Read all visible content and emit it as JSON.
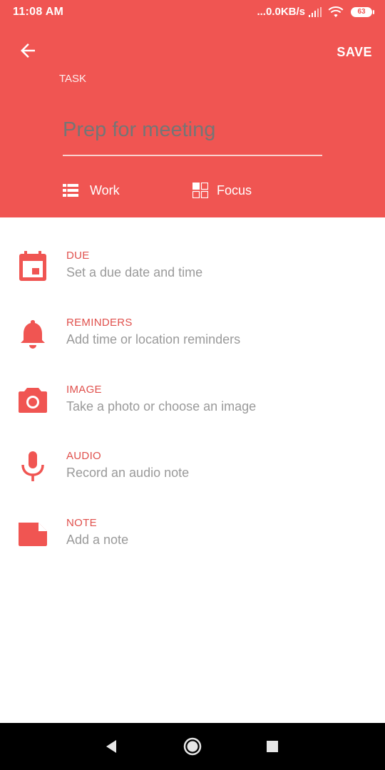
{
  "status": {
    "time": "11:08 AM",
    "network_speed": "...0.0KB/s",
    "battery": "63"
  },
  "header": {
    "back_icon": "arrow-back-icon",
    "save_label": "SAVE",
    "task_label": "TASK",
    "task_placeholder": "Prep for meeting",
    "list_chip": {
      "icon": "list-icon",
      "label": "Work"
    },
    "focus_chip": {
      "icon": "grid-icon",
      "label": "Focus"
    }
  },
  "options": [
    {
      "icon": "calendar-icon",
      "title": "DUE",
      "subtitle": "Set a due date and time"
    },
    {
      "icon": "bell-icon",
      "title": "REMINDERS",
      "subtitle": "Add time or location reminders"
    },
    {
      "icon": "camera-icon",
      "title": "IMAGE",
      "subtitle": "Take a photo or choose an image"
    },
    {
      "icon": "microphone-icon",
      "title": "AUDIO",
      "subtitle": "Record an audio note"
    },
    {
      "icon": "note-icon",
      "title": "NOTE",
      "subtitle": "Add a note"
    }
  ],
  "colors": {
    "accent": "#f05552",
    "accent_text": "#e0504c",
    "subtitle": "#9a9a9a"
  }
}
